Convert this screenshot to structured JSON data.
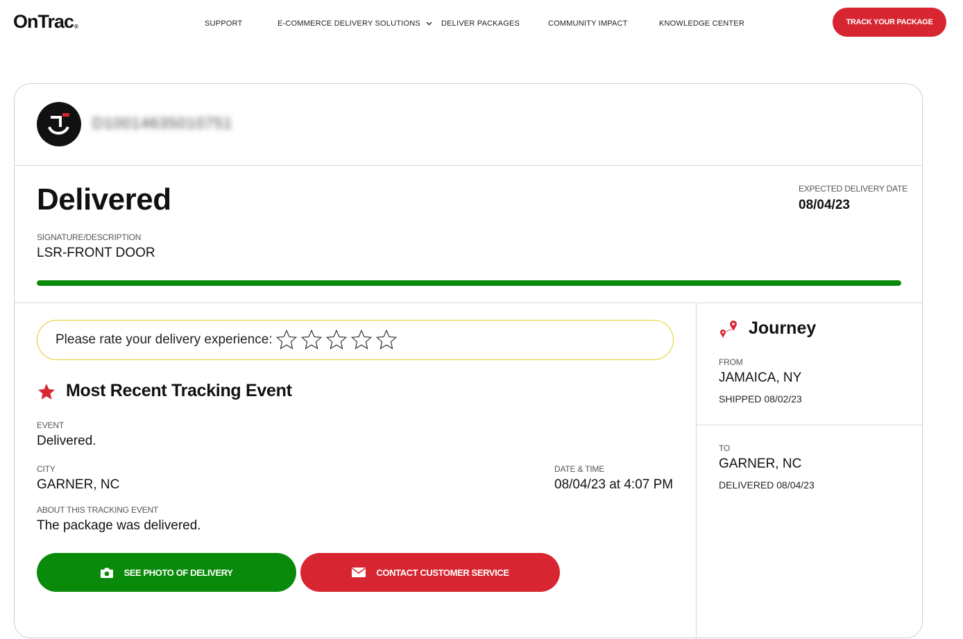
{
  "brand": {
    "logo_text": "OnTrac",
    "logo_mark": "®"
  },
  "nav": {
    "items": [
      {
        "label": "SUPPORT"
      },
      {
        "label": "E-COMMERCE DELIVERY SOLUTIONS"
      },
      {
        "label": "DELIVER PACKAGES"
      },
      {
        "label": "COMMUNITY IMPACT"
      },
      {
        "label": "KNOWLEDGE CENTER"
      }
    ],
    "cta_label": "TRACK YOUR PACKAGE"
  },
  "package": {
    "tracking_number": "D10014635010751",
    "status": "Delivered",
    "expected_label": "EXPECTED DELIVERY DATE",
    "expected_value": "08/04/23",
    "signature_label": "SIGNATURE/DESCRIPTION",
    "signature_value": "LSR-FRONT DOOR",
    "progress_percent": 100
  },
  "rating": {
    "prompt": "Please rate your delivery experience:",
    "star_count": 5
  },
  "recent_event": {
    "section_title": "Most Recent Tracking Event",
    "event_label": "EVENT",
    "event_value": "Delivered.",
    "city_label": "CITY",
    "city_value": "GARNER, NC",
    "datetime_label": "DATE & TIME",
    "datetime_value": "08/04/23 at 4:07 PM",
    "about_label": "ABOUT THIS TRACKING EVENT",
    "about_value": "The package was delivered."
  },
  "actions": {
    "photo_label": "SEE PHOTO OF DELIVERY",
    "contact_label": "CONTACT CUSTOMER SERVICE"
  },
  "journey": {
    "title": "Journey",
    "from_label": "FROM",
    "from_value": "JAMAICA, NY",
    "shipped_value": "SHIPPED 08/02/23",
    "to_label": "TO",
    "to_value": "GARNER, NC",
    "delivered_value": "DELIVERED 08/04/23"
  },
  "colors": {
    "brand_red": "#d72631",
    "progress_green": "#0a8a0a",
    "rating_border": "#e3cc23"
  }
}
